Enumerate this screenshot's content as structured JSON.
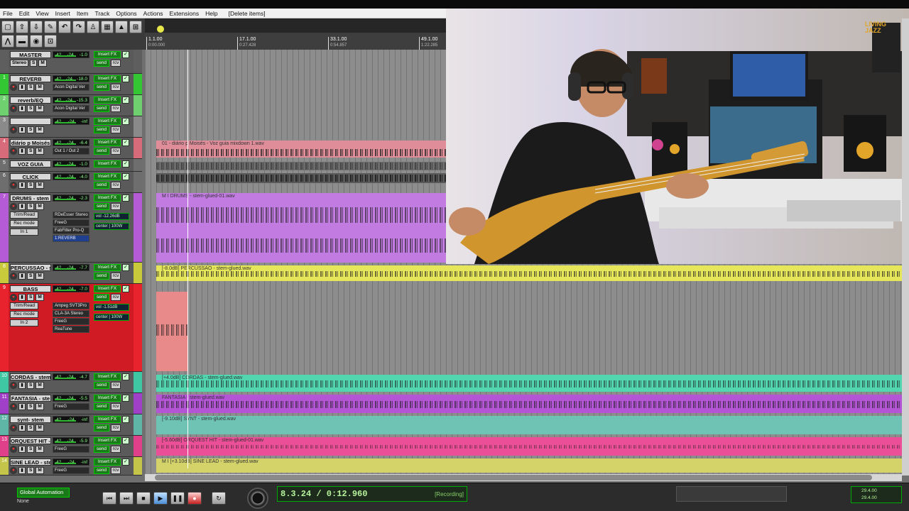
{
  "menu": [
    "File",
    "Edit",
    "View",
    "Insert",
    "Item",
    "Track",
    "Options",
    "Actions",
    "Extensions",
    "Help"
  ],
  "action_label": "[Delete items]",
  "toolbar_icons": [
    "new-project-icon",
    "open-icon",
    "save-icon",
    "settings-icon",
    "undo-icon",
    "redo-icon",
    "metronome-icon",
    "grid-icon",
    "ripple-icon",
    "snap-icon",
    "envelope-icon",
    "crossfade-icon",
    "loop-icon",
    "lock-icon"
  ],
  "ruler": {
    "marks": [
      {
        "bar": "1.1.00",
        "time": "0:00.000"
      },
      {
        "bar": "17.1.00",
        "time": "0:27.428"
      },
      {
        "bar": "33.1.00",
        "time": "0:54.857"
      },
      {
        "bar": "49.1.00",
        "time": "1:22.285"
      }
    ]
  },
  "tracks": [
    {
      "num": "",
      "name": "MASTER",
      "color": "#5e5e5e",
      "vol": "-42",
      "pan": "-24",
      "peak": "-1.0",
      "fx": "Insert FX",
      "row2": [
        "Stereo",
        "S",
        "M"
      ],
      "send": "send",
      "rcv": "rcv"
    },
    {
      "num": "1",
      "name": "REVERB",
      "color": "#34c734",
      "vol": "-42",
      "pan": "-24",
      "peak": "-18.0",
      "fx": "Insert FX",
      "slot": "Acon Digital Ver",
      "send": "send",
      "rcv": "rcv"
    },
    {
      "num": "2",
      "name": "reverb/EQ",
      "color": "#6fd06f",
      "vol": "-42",
      "pan": "-24",
      "peak": "-15.3",
      "fx": "Insert FX",
      "slot": "Acon Digital Ver",
      "send": "send",
      "rcv": "rcv"
    },
    {
      "num": "3",
      "name": "",
      "color": "#8a8a8a",
      "vol": "-42",
      "pan": "-24",
      "peak": "-inf",
      "fx": "Insert FX",
      "send": "send",
      "rcv": "rcv"
    },
    {
      "num": "4",
      "name": "diário p Moisés",
      "color": "#d86b7a",
      "vol": "-42",
      "pan": "-24",
      "peak": "-6.4",
      "fx": "Insert FX",
      "slot": "Out 1 / Out 2",
      "send": "send",
      "rcv": "rcv"
    },
    {
      "num": "5",
      "name": "VOZ GUIA",
      "color": "#6e6e6e",
      "vol": "-42",
      "pan": "-24",
      "peak": "-1.0",
      "fx": "Insert FX",
      "send": "send",
      "rcv": "rcv"
    },
    {
      "num": "6",
      "name": "CLICK",
      "color": "#6e6e6e",
      "vol": "-42",
      "pan": "-24",
      "peak": "-4.0",
      "fx": "Insert FX",
      "send": "send",
      "rcv": "rcv"
    },
    {
      "num": "7",
      "name": "DRUMS - stem",
      "color": "#b55bd6",
      "vol": "-42",
      "pan": "-24",
      "peak": "-2.3",
      "fx": "Insert FX",
      "slots": [
        "RDeEsser Stereo",
        "FreeG",
        "FabFilter Pro-Q",
        "1:REVERB"
      ],
      "buttons": [
        "Trim/Read",
        "Rec mode",
        "In 1"
      ],
      "volume": "vol -12.26dB",
      "pan_label": "center | 100W",
      "send": "send",
      "rcv": "rcv"
    },
    {
      "num": "8",
      "name": "PERCUSSAO - s",
      "color": "#c9c93c",
      "vol": "-42",
      "pan": "-24",
      "peak": "-7.7",
      "fx": "Insert FX",
      "send": "send",
      "rcv": "rcv"
    },
    {
      "num": "9",
      "name": "BASS",
      "color": "#e8232e",
      "vol": "-42",
      "pan": "-24",
      "peak": "-7.0",
      "fx": "Insert FX",
      "slots": [
        "Ampeg SVT3Pro",
        "CLA-3A Stereo",
        "FreeG",
        "ReaTune"
      ],
      "buttons": [
        "Trim/Read",
        "Rec mode",
        "In 2"
      ],
      "volume": "vol -1.51dB",
      "pan_label": "center | 100W",
      "send": "send",
      "rcv": "rcv"
    },
    {
      "num": "10",
      "name": "CORDAS - stem",
      "color": "#3fc7a3",
      "vol": "-42",
      "pan": "-24",
      "peak": "-4.7",
      "fx": "Insert FX",
      "send": "send",
      "rcv": "rcv"
    },
    {
      "num": "11",
      "name": "FANTASIA - ste",
      "color": "#a040c8",
      "vol": "-42",
      "pan": "-24",
      "peak": "-5.5",
      "fx": "Insert FX",
      "slot": "FreeG",
      "send": "send",
      "rcv": "rcv"
    },
    {
      "num": "12",
      "name": "synt- stem",
      "color": "#5fb5a6",
      "vol": "-42",
      "pan": "-24",
      "peak": "-inf",
      "fx": "Insert FX",
      "send": "send",
      "rcv": "rcv"
    },
    {
      "num": "13",
      "name": "ORQUEST HIT -",
      "color": "#e0408a",
      "vol": "-42",
      "pan": "-24",
      "peak": "-5.9",
      "fx": "Insert FX",
      "slot": "FreeG",
      "send": "send",
      "rcv": "rcv"
    },
    {
      "num": "14",
      "name": "SINE LEAD - ste",
      "color": "#c4c44a",
      "vol": "-42",
      "pan": "-24",
      "peak": "-inf",
      "fx": "Insert FX",
      "slot": "FreeG",
      "send": "send",
      "rcv": "rcv"
    }
  ],
  "items": {
    "diario": "01 - diário p Moisés - Voz guia mixdown 1.wav",
    "drums": "M I   DRUMS - stem-glued-01.wav",
    "percussao": "[-8.0dB] PERCUSSAO - stem-glued.wav",
    "cordas": "[+4.0dB] CORDAS - stem-glued.wav",
    "fantasia": "FANTASIA - stem-glued.wav",
    "synt": "[-9.10dB] SYNT - stem-glued.wav",
    "orquest": "[-5.60dB] ORQUEST HIT - stem-glued-01.wav",
    "sine": "M I   [+3.10dB] SINE LEAD - stem-glued.wav"
  },
  "transport": {
    "global_automation": "Global Automation",
    "global_none": "None",
    "time": "8.3.24 / 0:12.960",
    "status": "[Recording]",
    "rate_top": "29.4.00",
    "rate_bottom": "29.4.00",
    "buttons": [
      "go-to-start-icon",
      "go-to-end-icon",
      "stop-icon",
      "play-icon",
      "pause-icon",
      "record-icon",
      "repeat-icon"
    ]
  },
  "video_overlay": {
    "sign": "LIVING JAZZ"
  }
}
